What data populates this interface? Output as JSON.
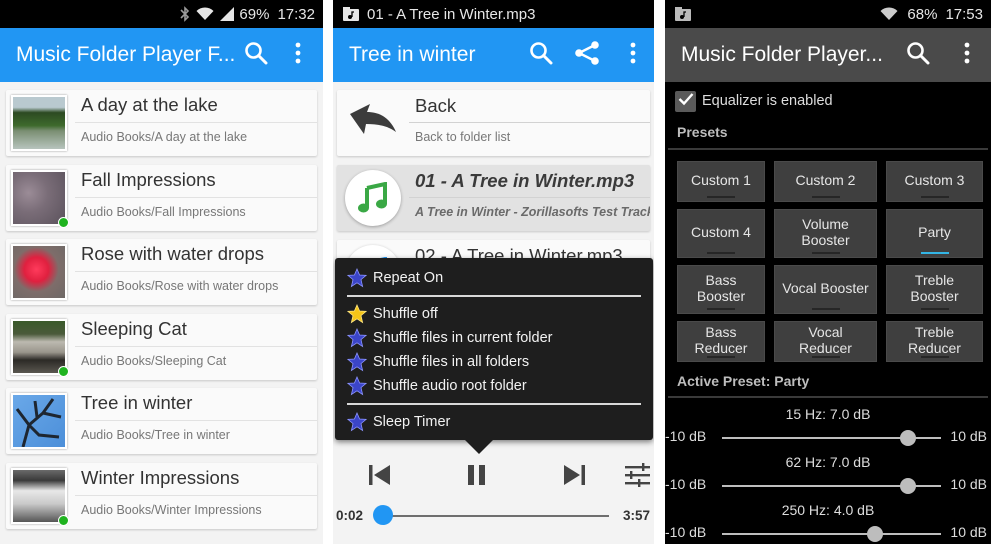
{
  "screens": {
    "folders": {
      "status": {
        "battery": "69%",
        "time": "17:32",
        "icons": [
          "bluetooth-icon",
          "wifi-icon",
          "signal-icon"
        ]
      },
      "appbar": {
        "title": "Music Folder Player F...",
        "actions": [
          "search-icon",
          "overflow-menu-icon"
        ]
      },
      "folders": [
        {
          "title": "A day at the lake",
          "path": "Audio Books/A day at the lake",
          "thumb": "lake",
          "has_indicator": false
        },
        {
          "title": "Fall Impressions",
          "path": "Audio Books/Fall Impressions",
          "thumb": "fall",
          "has_indicator": true
        },
        {
          "title": "Rose with water drops",
          "path": "Audio Books/Rose with water drops",
          "thumb": "rose",
          "has_indicator": false
        },
        {
          "title": "Sleeping Cat",
          "path": "Audio Books/Sleeping Cat",
          "thumb": "cat",
          "has_indicator": true
        },
        {
          "title": "Tree in winter",
          "path": "Audio Books/Tree in winter",
          "thumb": "tree",
          "has_indicator": false
        },
        {
          "title": "Winter Impressions",
          "path": "Audio Books/Winter Impressions",
          "thumb": "winter",
          "has_indicator": true
        }
      ],
      "indicator_color": "#1fb31f",
      "accent": "#2196f3"
    },
    "player": {
      "status": {
        "notification": "01 - A Tree in Winter.mp3"
      },
      "appbar": {
        "title": "Tree in winter",
        "actions": [
          "search-icon",
          "share-icon",
          "overflow-menu-icon"
        ]
      },
      "files": [
        {
          "title": "Back",
          "subtitle": "Back to folder list",
          "icon": "back-arrow-icon",
          "active": false
        },
        {
          "title": "01 - A Tree in Winter.mp3",
          "subtitle": "A Tree in Winter - Zorillasofts Test Tracks -",
          "icon": "music-note-icon",
          "active": true
        },
        {
          "title": "02 - A Tree in Winter.mp3",
          "subtitle": "",
          "icon": "music-note-icon",
          "active": false
        }
      ],
      "menu": {
        "groups": [
          [
            {
              "label": "Repeat On",
              "star": "blue"
            }
          ],
          [
            {
              "label": "Shuffle off",
              "star": "gold"
            },
            {
              "label": "Shuffle files in current folder",
              "star": "blue"
            },
            {
              "label": "Shuffle files in all folders",
              "star": "blue"
            },
            {
              "label": "Shuffle audio root folder",
              "star": "blue"
            }
          ],
          [
            {
              "label": "Sleep Timer",
              "star": "blue"
            }
          ]
        ]
      },
      "controls": [
        "previous-icon",
        "pause-icon",
        "next-icon",
        "equalizer-icon"
      ],
      "progress": {
        "elapsed": "0:02",
        "total": "3:57",
        "fraction": 0.008
      }
    },
    "equalizer": {
      "status": {
        "battery": "68%",
        "time": "17:53"
      },
      "appbar": {
        "title": "Music Folder Player...",
        "actions": [
          "search-icon",
          "overflow-menu-icon"
        ]
      },
      "enabled_label": "Equalizer is enabled",
      "enabled": true,
      "presets_label": "Presets",
      "presets": [
        {
          "label": "Custom 1",
          "active": false
        },
        {
          "label": "Custom 2",
          "active": false
        },
        {
          "label": "Custom 3",
          "active": false
        },
        {
          "label": "Custom 4",
          "active": false
        },
        {
          "label": "Volume Booster",
          "active": false
        },
        {
          "label": "Party",
          "active": true
        },
        {
          "label": "Bass Booster",
          "active": false
        },
        {
          "label": "Vocal Booster",
          "active": false
        },
        {
          "label": "Treble Booster",
          "active": false
        },
        {
          "label": "Bass Reducer",
          "active": false
        },
        {
          "label": "Vocal Reducer",
          "active": false
        },
        {
          "label": "Treble Reducer",
          "active": false
        }
      ],
      "active_preset_label": "Active Preset: Party",
      "range": {
        "min": -10,
        "max": 10,
        "min_label": "-10 dB",
        "max_label": "10 dB"
      },
      "bands": [
        {
          "label": "15 Hz: 7.0 dB",
          "value": 7.0
        },
        {
          "label": "62 Hz: 7.0 dB",
          "value": 7.0
        },
        {
          "label": "250 Hz: 4.0 dB",
          "value": 4.0
        }
      ],
      "active_color": "#33b5e5"
    }
  }
}
